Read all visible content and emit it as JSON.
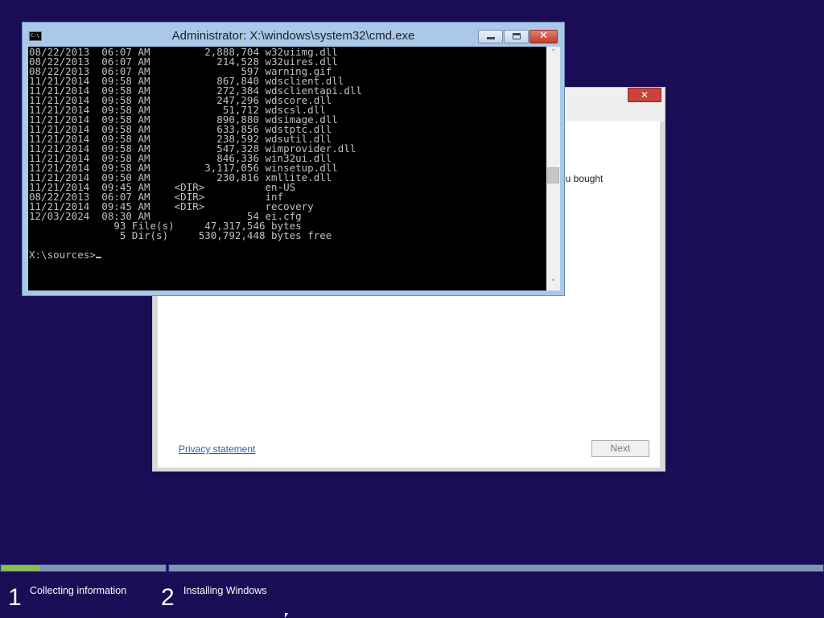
{
  "setup_dialog": {
    "close_label": "✕",
    "partial_text": "ou bought",
    "privacy_link": "Privacy statement",
    "next_label": "Next"
  },
  "cmd_window": {
    "title": "Administrator: X:\\windows\\system32\\cmd.exe",
    "icon_text": "C:\\",
    "lines": [
      "08/22/2013  06:07 AM         2,888,704 w32uiimg.dll",
      "08/22/2013  06:07 AM           214,528 w32uires.dll",
      "08/22/2013  06:07 AM               597 warning.gif",
      "11/21/2014  09:58 AM           867,840 wdsclient.dll",
      "11/21/2014  09:58 AM           272,384 wdsclientapi.dll",
      "11/21/2014  09:58 AM           247,296 wdscore.dll",
      "11/21/2014  09:58 AM            51,712 wdscsl.dll",
      "11/21/2014  09:58 AM           890,880 wdsimage.dll",
      "11/21/2014  09:58 AM           633,856 wdstptc.dll",
      "11/21/2014  09:58 AM           238,592 wdsutil.dll",
      "11/21/2014  09:58 AM           547,328 wimprovider.dll",
      "11/21/2014  09:58 AM           846,336 win32ui.dll",
      "11/21/2014  09:58 AM         3,117,056 winsetup.dll",
      "11/21/2014  09:50 AM           230,816 xmllite.dll",
      "11/21/2014  09:45 AM    <DIR>          en-US",
      "08/22/2013  06:07 AM    <DIR>          inf",
      "11/21/2014  09:45 AM    <DIR>          recovery",
      "12/03/2024  08:30 AM                54 ei.cfg",
      "              93 File(s)     47,317,546 bytes",
      "               5 Dir(s)     530,792,448 bytes free",
      "",
      "X:\\sources>"
    ],
    "scroll_up": "˄",
    "scroll_down": "˅"
  },
  "progress": {
    "steps": [
      {
        "number": "1",
        "label": "Collecting information",
        "fill_fraction": 0.23
      },
      {
        "number": "2",
        "label": "Installing Windows",
        "fill_fraction": 0
      }
    ]
  },
  "colors": {
    "desktop_bg": "#1a0d55",
    "progress_fill": "#8ac43f",
    "progress_track": "#7f94b3",
    "console_text": "#c0c0c0"
  }
}
